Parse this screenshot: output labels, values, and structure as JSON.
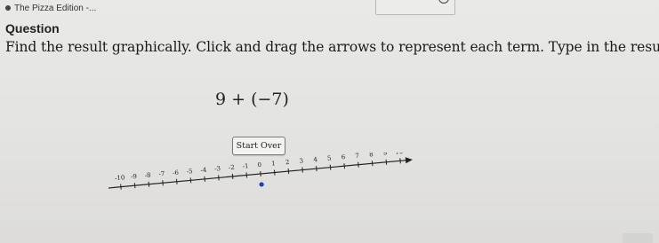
{
  "tab": {
    "title": "The Pizza Edition -..."
  },
  "question": {
    "label": "Question"
  },
  "instructions": "Find the result graphically. Click and drag the arrows to represent each term. Type in the result.",
  "expression": "9 + (−7)",
  "controls": {
    "start_over_label": "Start Over"
  },
  "number_line": {
    "min": -10,
    "max": 10,
    "tick_labels": [
      "-10",
      "-9",
      "-8",
      "-7",
      "-6",
      "-5",
      "-4",
      "-3",
      "-2",
      "-1",
      "0",
      "1",
      "2",
      "3",
      "4",
      "5",
      "6",
      "7",
      "8",
      "9",
      "10"
    ],
    "start_point": 0,
    "point_color": "#1f3fb0"
  }
}
